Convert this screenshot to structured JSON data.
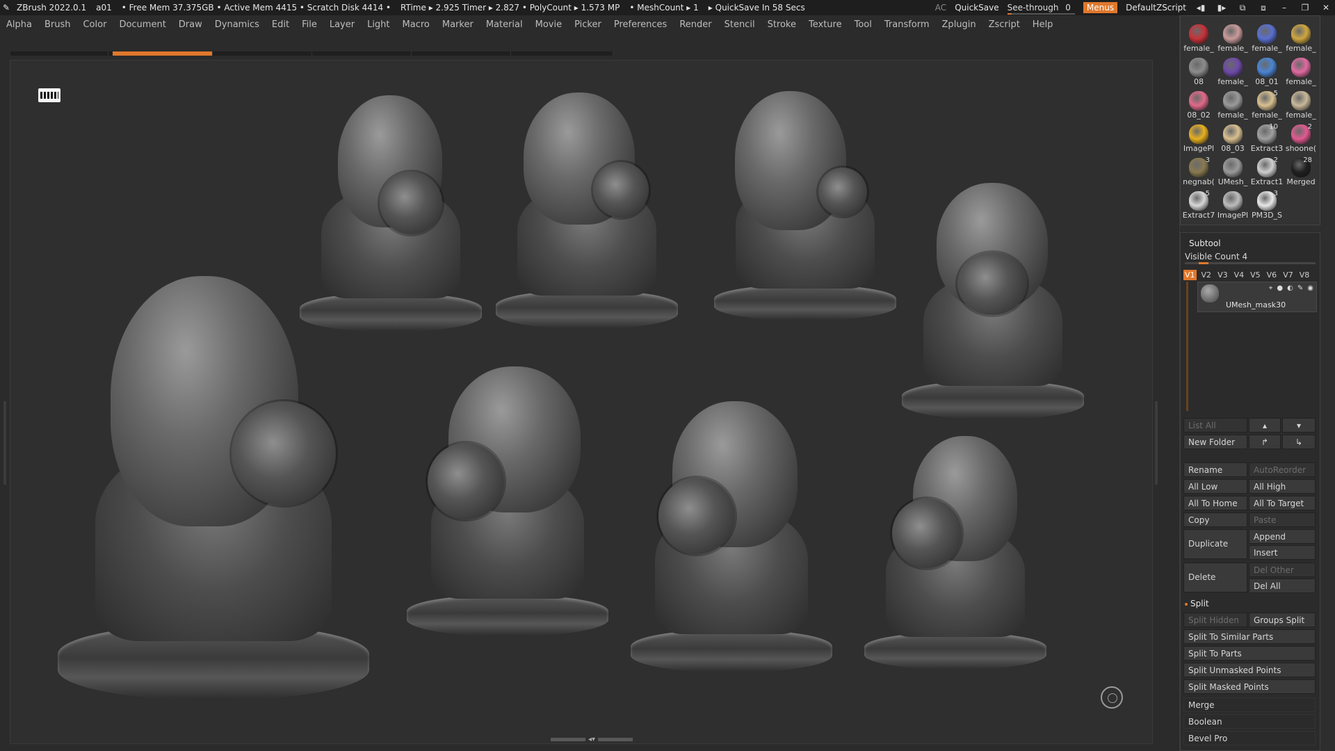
{
  "titlebar": {
    "app": "ZBrush 2022.0.1",
    "doc": "a01",
    "stats": "• Free Mem 37.375GB • Active Mem 4415 • Scratch Disk 4414 •",
    "rtime": "RTime ▸ 2.925 Timer ▸ 2.827 • PolyCount ▸ 1.573 MP",
    "mesh": "• MeshCount ▸ 1",
    "quicksave_msg": "▸ QuickSave In 58 Secs",
    "ac": "AC",
    "quicksave": "QuickSave",
    "seethrough": "See-through",
    "seethrough_value": "0",
    "menus": "Menus",
    "zscript": "DefaultZScript"
  },
  "menu": [
    "Alpha",
    "Brush",
    "Color",
    "Document",
    "Draw",
    "Dynamics",
    "Edit",
    "File",
    "Layer",
    "Light",
    "Macro",
    "Marker",
    "Material",
    "Movie",
    "Picker",
    "Preferences",
    "Render",
    "Stencil",
    "Stroke",
    "Texture",
    "Tool",
    "Transform",
    "Zplugin",
    "Zscript",
    "Help"
  ],
  "tools": [
    {
      "label": "female_",
      "color": "#c8323a"
    },
    {
      "label": "female_",
      "color": "#c99a9a"
    },
    {
      "label": "female_",
      "color": "#5a6fd0"
    },
    {
      "label": "female_",
      "color": "#cfa640"
    },
    {
      "label": "08",
      "color": "#8c8c8c"
    },
    {
      "label": "female_",
      "color": "#6d4aa8"
    },
    {
      "label": "08_01",
      "color": "#4b84d2"
    },
    {
      "label": "female_",
      "color": "#e06aa0"
    },
    {
      "label": "08_02",
      "color": "#e06a8a"
    },
    {
      "label": "female_",
      "color": "#9a9a9a"
    },
    {
      "label": "female_",
      "color": "#d8c090",
      "count": "5"
    },
    {
      "label": "female_",
      "color": "#c9b89a"
    },
    {
      "label": "ImagePl",
      "color": "#e8b020"
    },
    {
      "label": "08_03",
      "color": "#d8c090"
    },
    {
      "label": "Extract3",
      "color": "#a0a0a0",
      "count": "10"
    },
    {
      "label": "shoone(",
      "color": "#e05a90",
      "count": "2"
    },
    {
      "label": "negnab(",
      "color": "#8a7a50",
      "count": "3"
    },
    {
      "label": "UMesh_",
      "color": "#9a9a9a"
    },
    {
      "label": "Extract1",
      "color": "#cfcfcf",
      "count": "2"
    },
    {
      "label": "Merged",
      "color": "#202020",
      "count": "28"
    },
    {
      "label": "Extract7",
      "color": "#d8d8d8",
      "count": "5"
    },
    {
      "label": "ImagePl",
      "color": "#bdbdbd"
    },
    {
      "label": "PM3D_S",
      "color": "#e8e8e8",
      "count": "3"
    }
  ],
  "subtool": {
    "title": "Subtool",
    "visible": "Visible Count 4",
    "tabs": [
      "V1",
      "V2",
      "V3",
      "V4",
      "V5",
      "V6",
      "V7",
      "V8"
    ],
    "item": "UMesh_mask30",
    "list_all": "List All",
    "new_folder": "New Folder",
    "rename": "Rename",
    "autoreorder": "AutoReorder",
    "all_low": "All Low",
    "all_high": "All High",
    "all_to_home": "All To Home",
    "all_to_target": "All To Target",
    "copy": "Copy",
    "paste": "Paste",
    "duplicate": "Duplicate",
    "append": "Append",
    "insert": "Insert",
    "delete": "Delete",
    "del_other": "Del Other",
    "del_all": "Del All",
    "split": "Split",
    "split_hidden": "Split Hidden",
    "groups_split": "Groups Split",
    "split_similar": "Split To Similar Parts",
    "split_parts": "Split To Parts",
    "split_unmasked": "Split Unmasked Points",
    "split_masked": "Split Masked Points",
    "merge": "Merge",
    "boolean": "Boolean",
    "bevel_pro": "Bevel Pro"
  },
  "colors": {
    "accent": "#e0782c",
    "bg": "#2b2b2b",
    "viewport": "#2f2f2f"
  }
}
